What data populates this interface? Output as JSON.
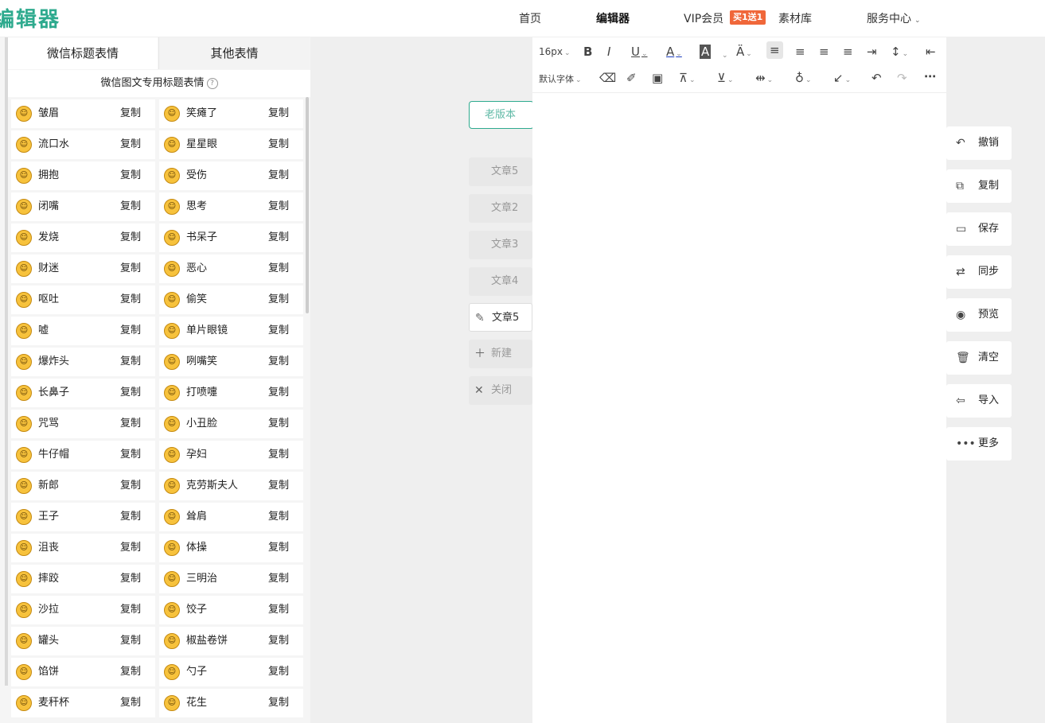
{
  "logo": "编辑器",
  "nav": {
    "home": "首页",
    "editor": "编辑器",
    "vip": "VIP会员",
    "vip_badge": "买1送1",
    "materials": "素材库",
    "service": "服务中心"
  },
  "panel": {
    "tab_active": "微信标题表情",
    "tab_other": "其他表情",
    "subtitle": "微信图文专用标题表情",
    "help_icon": "?",
    "copy_label": "复制",
    "emojis": [
      [
        "皱眉",
        "笑瘫了"
      ],
      [
        "流口水",
        "星星眼"
      ],
      [
        "拥抱",
        "受伤"
      ],
      [
        "闭嘴",
        "思考"
      ],
      [
        "发烧",
        "书呆子"
      ],
      [
        "财迷",
        "恶心"
      ],
      [
        "呕吐",
        "偷笑"
      ],
      [
        "嘘",
        "单片眼镜"
      ],
      [
        "爆炸头",
        "咧嘴笑"
      ],
      [
        "长鼻子",
        "打喷嚏"
      ],
      [
        "咒骂",
        "小丑脸"
      ],
      [
        "牛仔帽",
        "孕妇"
      ],
      [
        "新郎",
        "克劳斯夫人"
      ],
      [
        "王子",
        "耸肩"
      ],
      [
        "沮丧",
        "体操"
      ],
      [
        "摔跤",
        "三明治"
      ],
      [
        "沙拉",
        "饺子"
      ],
      [
        "罐头",
        "椒盐卷饼"
      ],
      [
        "馅饼",
        "勺子"
      ],
      [
        "麦秆杯",
        "花生"
      ]
    ]
  },
  "articles": {
    "old_version": "老版本",
    "items": [
      "文章5",
      "文章2",
      "文章3",
      "文章4"
    ],
    "current": "文章5",
    "new": "新建",
    "close": "关闭"
  },
  "toolbar": {
    "font_size": "16px",
    "font_family": "默认字体"
  },
  "side_actions": [
    "撤销",
    "复制",
    "保存",
    "同步",
    "预览",
    "清空",
    "导入",
    "更多"
  ]
}
